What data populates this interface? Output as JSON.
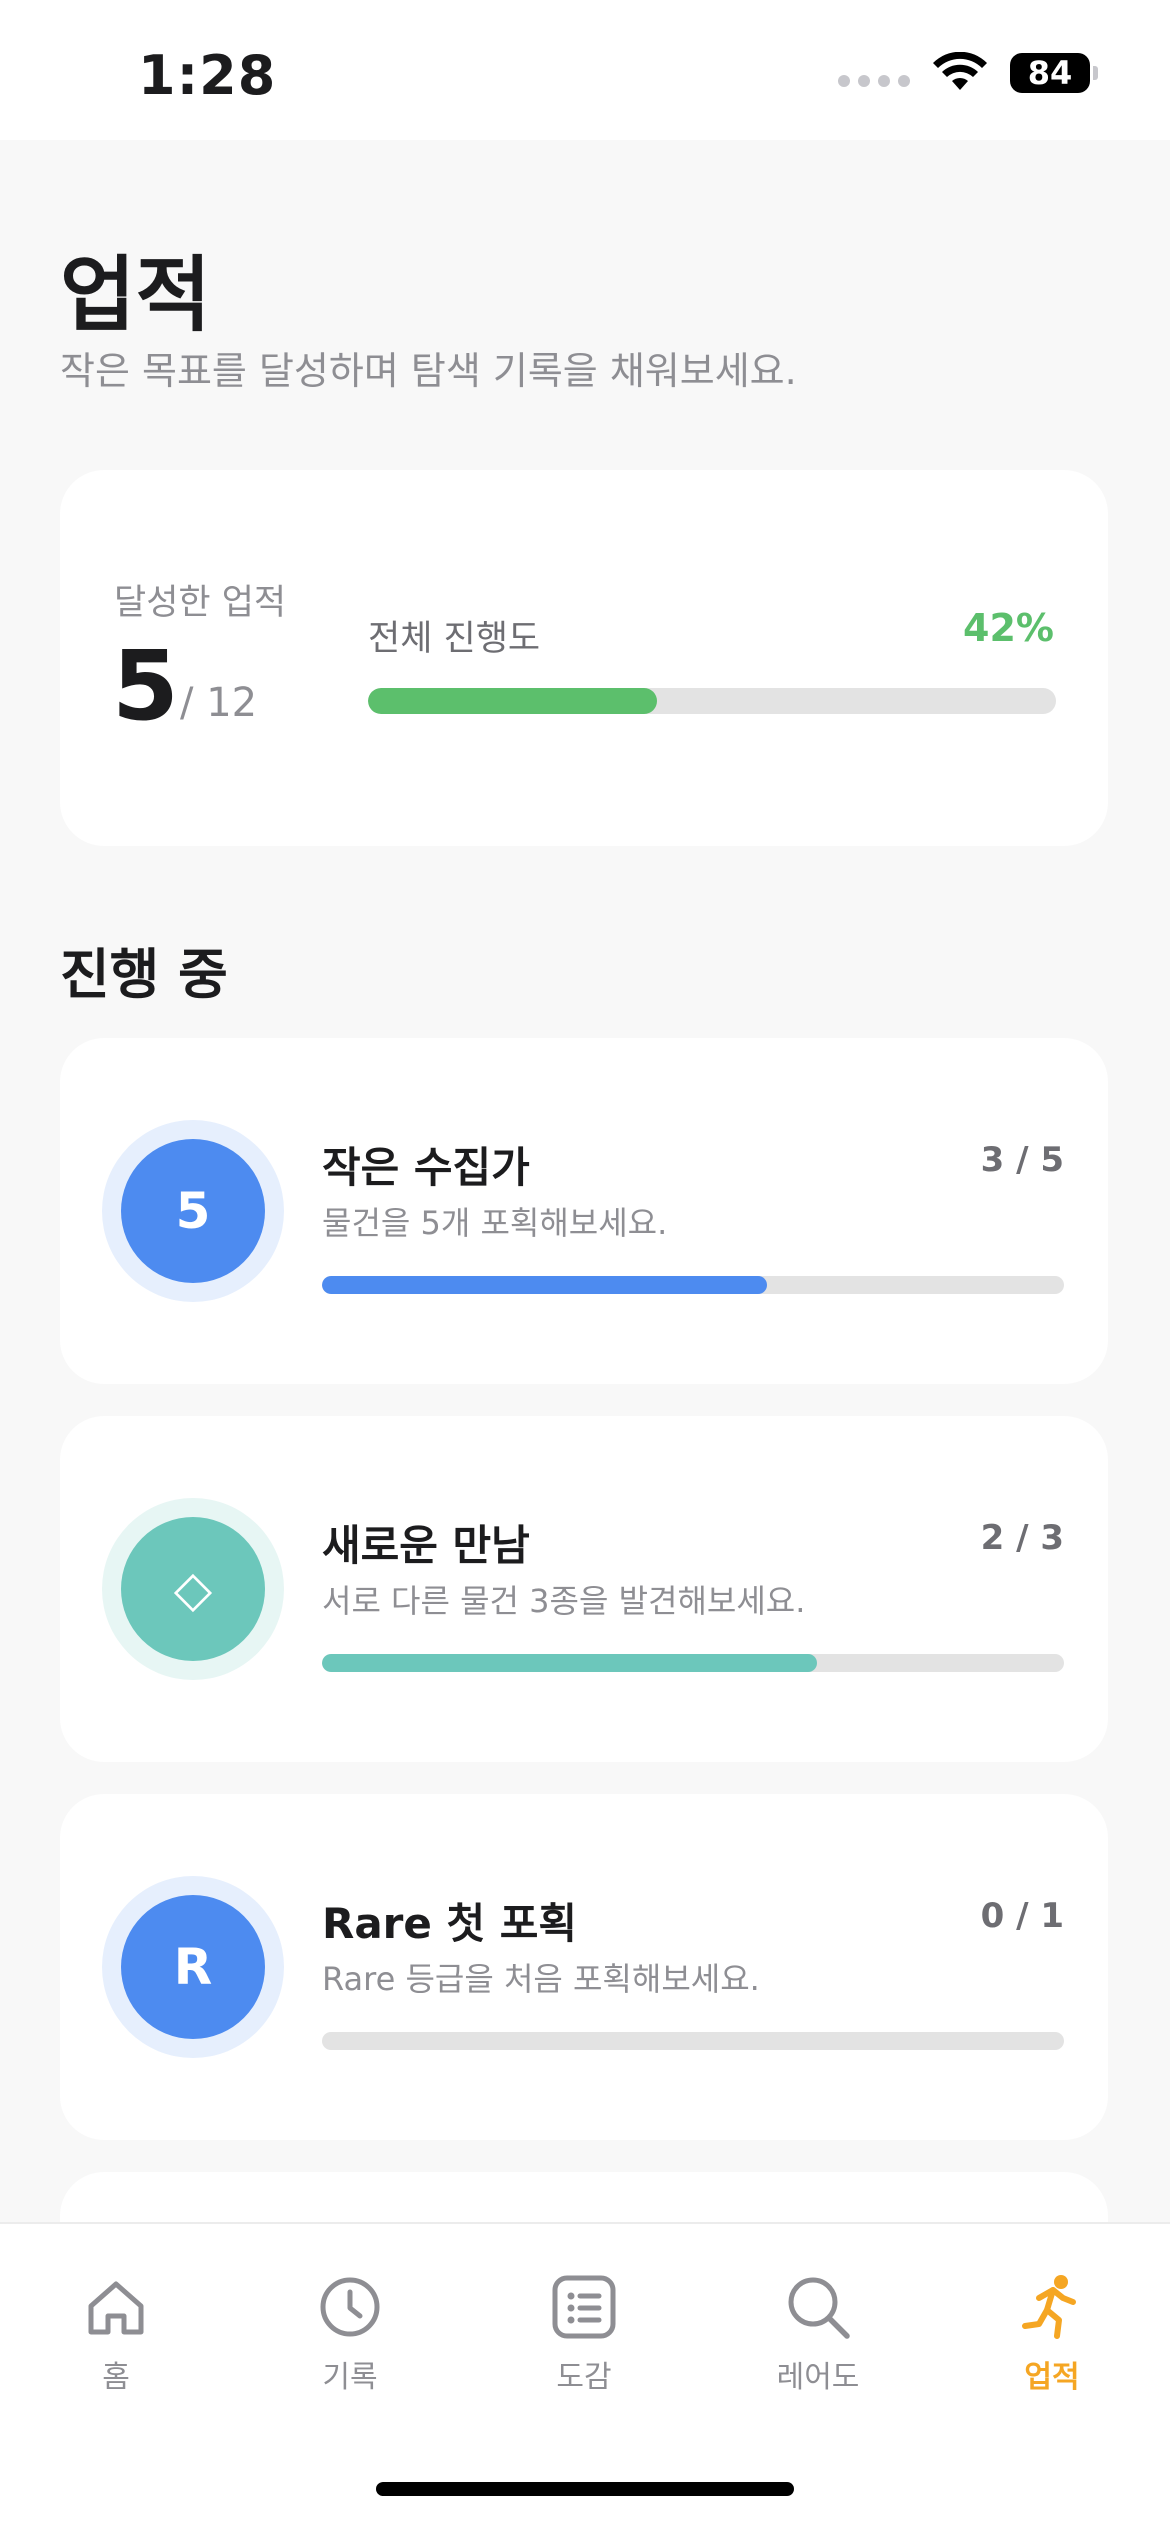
{
  "status_bar": {
    "time": "1:28",
    "battery": "84"
  },
  "header": {
    "title": "업적",
    "subtitle": "작은 목표를 달성하며 탐색 기록을 채워보세요."
  },
  "summary": {
    "achieved_label": "달성한 업적",
    "achieved_count": "5",
    "achieved_total": "/ 12",
    "overall_label": "전체 진행도",
    "overall_percent": "42%",
    "overall_progress": 0.42
  },
  "section": {
    "in_progress_title": "진행 중"
  },
  "achievements": [
    {
      "badge": "5",
      "title": "작은 수집가",
      "description": "물건을 5개 포획해보세요.",
      "count": "3 / 5",
      "progress": 0.6,
      "color": "#4d8bf0",
      "ring_color": "#e6effd"
    },
    {
      "badge": "◇",
      "title": "새로운 만남",
      "description": "서로 다른 물건 3종을 발견해보세요.",
      "count": "2 / 3",
      "progress": 0.667,
      "color": "#6cc7bb",
      "ring_color": "#e7f6f4"
    },
    {
      "badge": "R",
      "title": "Rare 첫 포획",
      "description": "Rare 등급을 처음 포획해보세요.",
      "count": "0 / 1",
      "progress": 0,
      "color": "#4d8bf0",
      "ring_color": "#e6effd"
    }
  ],
  "tabs": [
    {
      "label": "홈",
      "icon": "home-icon"
    },
    {
      "label": "기록",
      "icon": "clock-icon"
    },
    {
      "label": "도감",
      "icon": "list-icon"
    },
    {
      "label": "레어도",
      "icon": "search-icon"
    },
    {
      "label": "업적",
      "icon": "runner-icon",
      "active": true
    }
  ],
  "colors": {
    "accent": "#f5a623",
    "progress_green": "#5cbf6c",
    "inactive": "#8e8e93"
  }
}
